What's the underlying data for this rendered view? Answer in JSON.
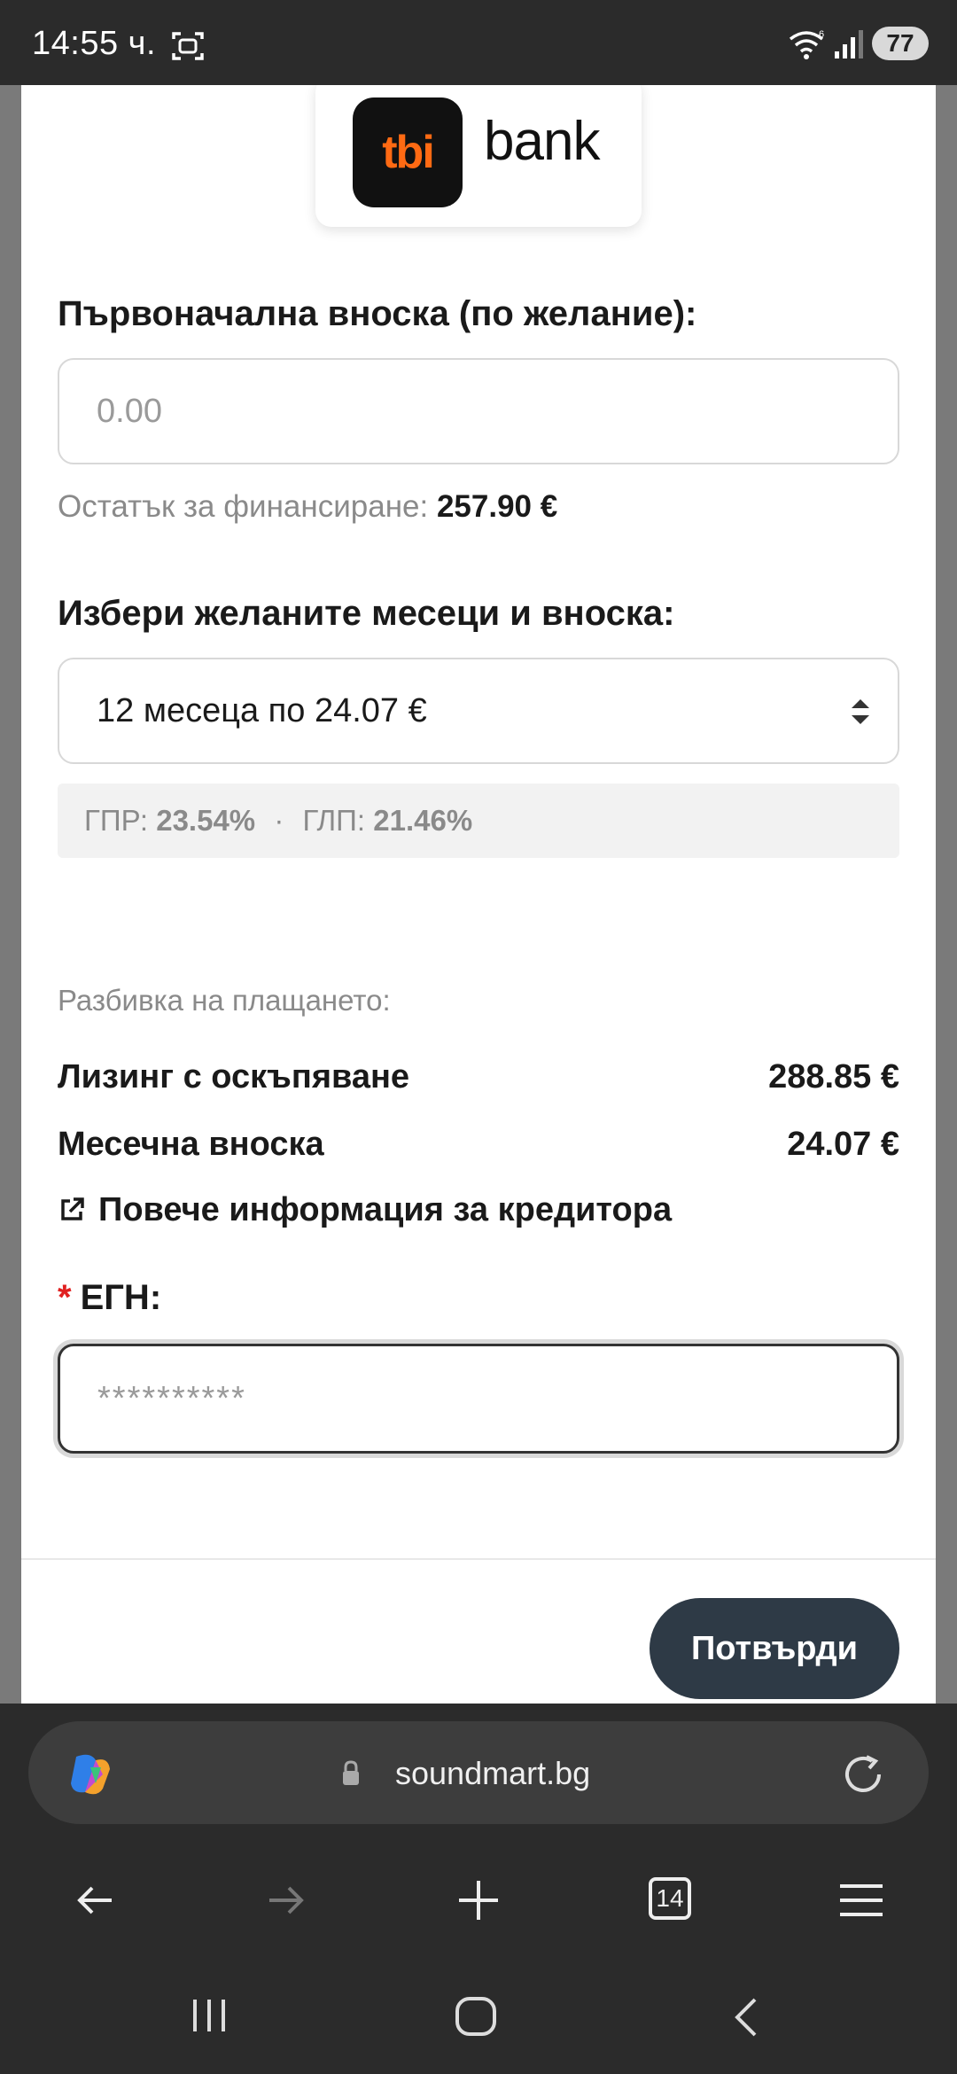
{
  "status_bar": {
    "time": "14:55 ч.",
    "battery": "77"
  },
  "logo": {
    "mark": "tbi",
    "word": "bank"
  },
  "down_payment": {
    "label": "Първоначална вноска (по желание):",
    "placeholder": "0.00"
  },
  "remaining": {
    "label": "Остатък за финансиране:",
    "value": "257.90 €"
  },
  "months": {
    "label": "Избери желаните месеци и вноска:",
    "selected": "12 месеца по 24.07 €"
  },
  "rates": {
    "gpr_label": "ГПР:",
    "gpr_value": "23.54%",
    "separator": "·",
    "glp_label": "ГЛП:",
    "glp_value": "21.46%"
  },
  "breakdown": {
    "title": "Разбивка на плащането:",
    "rows": [
      {
        "label": "Лизинг с оскъпяване",
        "value": "288.85 €"
      },
      {
        "label": "Месечна вноска",
        "value": "24.07 €"
      }
    ]
  },
  "creditor_link": "Повече информация за кредитора",
  "egn": {
    "required_mark": "*",
    "label": "ЕГН:",
    "placeholder": "**********"
  },
  "confirm_button": "Потвърди",
  "browser": {
    "url": "soundmart.bg",
    "tab_count": "14"
  },
  "colors": {
    "accent_orange": "#ff6a13",
    "button_dark": "#2e3a46",
    "required_red": "#e02020"
  }
}
